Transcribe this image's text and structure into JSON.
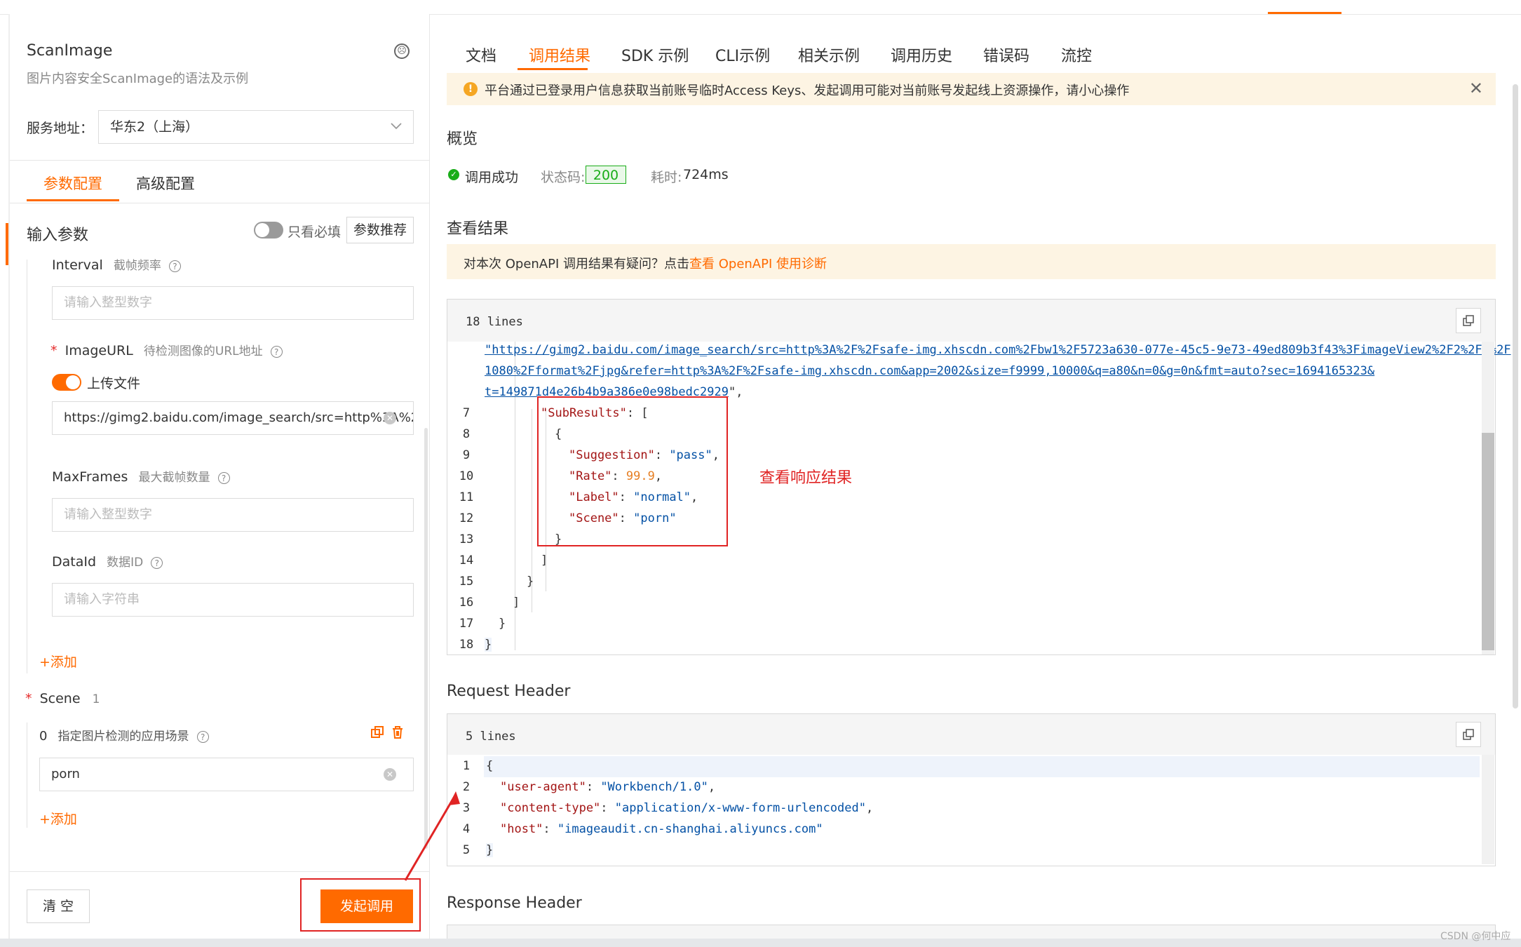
{
  "left": {
    "api_name": "ScanImage",
    "api_desc": "图片内容安全ScanImage的语法及示例",
    "service_label": "服务地址：",
    "service_value": "华东2（上海）",
    "tabs": [
      "参数配置",
      "高级配置"
    ],
    "input_params_label": "输入参数",
    "only_required_label": "只看必填",
    "recommend_button": "参数推荐",
    "params": {
      "interval": {
        "name": "Interval",
        "desc": "截帧频率",
        "placeholder": "请输入整型数字"
      },
      "imageurl": {
        "required_mark": "*",
        "name": "ImageURL",
        "desc": "待检测图像的URL地址",
        "upload_label": "上传文件",
        "value": "https://gimg2.baidu.com/image_search/src=http%3A%2"
      },
      "maxframes": {
        "name": "MaxFrames",
        "desc": "最大截帧数量",
        "placeholder": "请输入整型数字"
      },
      "dataid": {
        "name": "DataId",
        "desc": "数据ID",
        "placeholder": "请输入字符串"
      },
      "add_label": "+添加",
      "scene": {
        "required_mark": "*",
        "name": "Scene",
        "count": "1",
        "item_index": "0",
        "item_desc": "指定图片检测的应用场景",
        "value": "porn"
      },
      "add_label_2": "+添加"
    },
    "clear_button": "清 空",
    "invoke_button": "发起调用"
  },
  "right": {
    "tabs": [
      "文档",
      "调用结果",
      "SDK 示例",
      "CLI示例",
      "相关示例",
      "调用历史",
      "错误码",
      "流控"
    ],
    "active_tab": "调用结果",
    "warning": "平台通过已登录用户信息获取当前账号临时Access Keys、发起调用可能对当前账号发起线上资源操作，请小心操作",
    "overview_title": "概览",
    "status_success": "调用成功",
    "status_code_label": "状态码:",
    "status_code": "200",
    "time_label": "耗时:",
    "time_value": "724ms",
    "result_title": "查看结果",
    "diag_text": "对本次 OpenAPI 调用结果有疑问？点击",
    "diag_link": "查看 OpenAPI 使用诊断",
    "response_lines": "18 lines",
    "url_line1": "\"https://gimg2.baidu.com/image_search/src=http%3A%2F%2Fsafe-img.xhscdn.com%2Fbw1%2F5723a630-077e-45c5-9e73-49ed809b3f43%3FimageView2%2F2%2Fw%2F",
    "url_line2": "1080%2Fformat%2Fjpg&refer=http%3A%2F%2Fsafe-img.xhscdn.com&app=2002&size=f9999,10000&q=a80&n=0&g=0n&fmt=auto?sec=1694165323&",
    "url_line3": "t=149871d4e26b4b9a386e0e98bedc2929",
    "url_line3_tail": "\",",
    "code": {
      "l7": {
        "n": "7",
        "key": "\"SubResults\"",
        "rest": ": ["
      },
      "l8": {
        "n": "8",
        "text": "{"
      },
      "l9": {
        "n": "9",
        "key": "\"Suggestion\"",
        "colon": ": ",
        "val": "\"pass\"",
        "tail": ","
      },
      "l10": {
        "n": "10",
        "key": "\"Rate\"",
        "colon": ": ",
        "val": "99.9",
        "tail": ","
      },
      "l11": {
        "n": "11",
        "key": "\"Label\"",
        "colon": ": ",
        "val": "\"normal\"",
        "tail": ","
      },
      "l12": {
        "n": "12",
        "key": "\"Scene\"",
        "colon": ": ",
        "val": "\"porn\""
      },
      "l13": {
        "n": "13",
        "text": "}"
      },
      "l14": {
        "n": "14",
        "text": "]"
      },
      "l15": {
        "n": "15",
        "text": "}"
      },
      "l16": {
        "n": "16",
        "text": "]"
      },
      "l17": {
        "n": "17",
        "text": "}"
      },
      "l18": {
        "n": "18",
        "text": "}"
      }
    },
    "annotation": "查看响应结果",
    "request_header_title": "Request Header",
    "request_lines": "5 lines",
    "req": {
      "l1": {
        "n": "1",
        "text": "{"
      },
      "l2": {
        "n": "2",
        "key": "\"user-agent\"",
        "colon": ": ",
        "val": "\"Workbench/1.0\"",
        "tail": ","
      },
      "l3": {
        "n": "3",
        "key": "\"content-type\"",
        "colon": ": ",
        "val": "\"application/x-www-form-urlencoded\"",
        "tail": ","
      },
      "l4": {
        "n": "4",
        "key": "\"host\"",
        "colon": ": ",
        "val": "\"imageaudit.cn-shanghai.aliyuncs.com\""
      },
      "l5": {
        "n": "5",
        "text": "}"
      }
    },
    "response_header_title": "Response Header",
    "watermark": "CSDN @何中应"
  },
  "colors": {
    "accent": "#ff6a00",
    "success": "#1aad19",
    "annotation_red": "#e02424"
  }
}
